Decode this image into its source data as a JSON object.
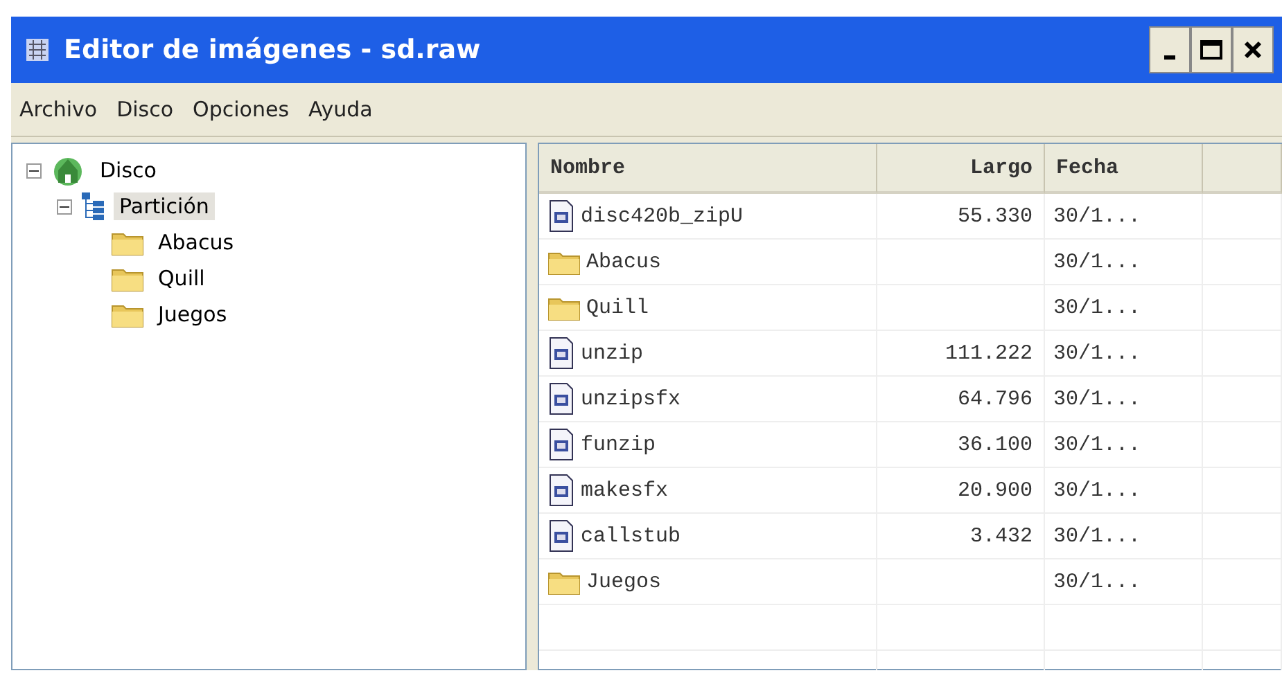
{
  "window": {
    "title": "Editor de imágenes - sd.raw"
  },
  "menu": [
    "Archivo",
    "Disco",
    "Opciones",
    "Ayuda"
  ],
  "tree": [
    {
      "label": "Disco",
      "kind": "disk",
      "expanded": true,
      "selected": false,
      "children": [
        {
          "label": "Partición",
          "kind": "partition",
          "expanded": true,
          "selected": true,
          "children": [
            {
              "label": "Abacus",
              "kind": "folder",
              "selected": false
            },
            {
              "label": "Quill",
              "kind": "folder",
              "selected": false
            },
            {
              "label": "Juegos",
              "kind": "folder",
              "selected": false
            }
          ]
        }
      ]
    }
  ],
  "table": {
    "columns": [
      "Nombre",
      "Largo",
      "Fecha"
    ],
    "rows": [
      {
        "kind": "file",
        "name": "disc420b_zipU",
        "size": "55.330",
        "date": "30/1..."
      },
      {
        "kind": "folder",
        "name": "Abacus",
        "date": "30/1..."
      },
      {
        "kind": "folder",
        "name": "Quill",
        "date": "30/1..."
      },
      {
        "kind": "file",
        "name": "unzip",
        "size": "111.222",
        "date": "30/1..."
      },
      {
        "kind": "file",
        "name": "unzipsfx",
        "size": "64.796",
        "date": "30/1..."
      },
      {
        "kind": "file",
        "name": "funzip",
        "size": "36.100",
        "date": "30/1..."
      },
      {
        "kind": "file",
        "name": "makesfx",
        "size": "20.900",
        "date": "30/1..."
      },
      {
        "kind": "file",
        "name": "callstub",
        "size": "3.432",
        "date": "30/1..."
      },
      {
        "kind": "folder",
        "name": "Juegos",
        "date": "30/1..."
      }
    ]
  }
}
